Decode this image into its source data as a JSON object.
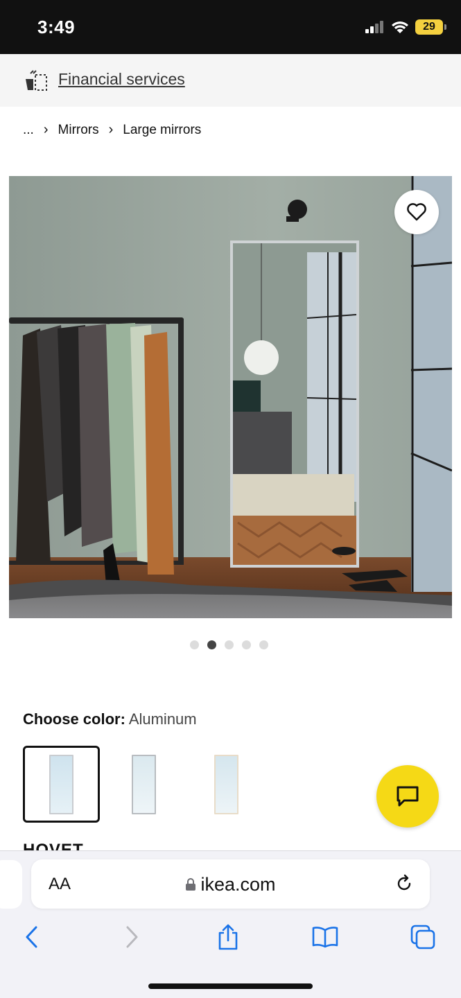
{
  "status_bar": {
    "time": "3:49",
    "battery": "29"
  },
  "financial_bar": {
    "link_label": "Financial services",
    "icon": "financial-services-icon"
  },
  "breadcrumb": {
    "ellipsis": "...",
    "items": [
      "Mirrors",
      "Large mirrors"
    ],
    "separator": "›"
  },
  "gallery": {
    "image_alt": "Room with clothes rack and large aluminum floor mirror",
    "favorite_icon": "heart-icon",
    "dot_count": 5,
    "active_dot": 2
  },
  "color_chooser": {
    "label": "Choose color:",
    "value": "Aluminum",
    "swatches": [
      {
        "name": "Aluminum",
        "selected": true,
        "frame": "#c9ccd0"
      },
      {
        "name": "White",
        "selected": false,
        "frame": "#b8bcc0"
      },
      {
        "name": "Beige",
        "selected": false,
        "frame": "#e8dcc8"
      }
    ]
  },
  "cut_heading": "HOVET",
  "chat": {
    "icon": "chat-icon"
  },
  "safari": {
    "aa_label": "AA",
    "url": "ikea.com",
    "tint": "#1a73e8"
  }
}
